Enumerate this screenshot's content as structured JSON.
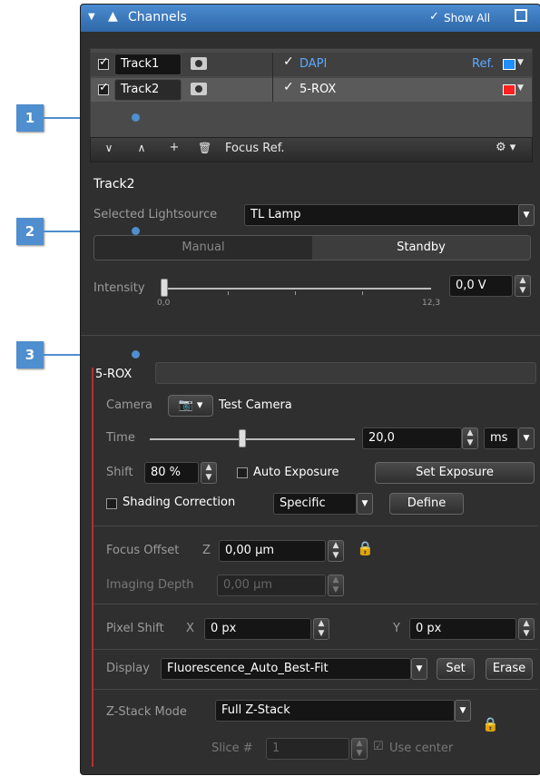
{
  "header": {
    "title": "Channels",
    "show_all": "Show All"
  },
  "channels": {
    "tracks": [
      {
        "track": "Track1",
        "checked": true,
        "channel": "DAPI",
        "ref": "Ref.",
        "color": "#1f8fff",
        "selected": false
      },
      {
        "track": "Track2",
        "checked": true,
        "channel": "5-ROX",
        "ref": "",
        "color": "#ff2020",
        "selected": true
      }
    ],
    "toolbar": {
      "down": "⌄",
      "up": "^",
      "add": "+",
      "focus_ref": "Focus Ref.",
      "gear": "⚙"
    }
  },
  "track": {
    "title": "Track2",
    "lightsource_label": "Selected Lightsource",
    "lightsource_value": "TL Lamp",
    "modes": [
      "Manual",
      "Standby"
    ],
    "active_mode": "Standby",
    "intensity_label": "Intensity",
    "intensity_min": "0,0",
    "intensity_max": "12,3",
    "intensity_value": "0,0 V",
    "intensity_fraction": 0.0
  },
  "channel": {
    "name": "5-ROX",
    "camera_label": "Camera",
    "camera_value": "Test Camera",
    "time_label": "Time",
    "time_value": "20,0",
    "time_unit": "ms",
    "time_slider_fraction": 0.47,
    "shift_label": "Shift",
    "shift_value": "80 %",
    "auto_exposure": "Auto Exposure",
    "set_exposure": "Set Exposure",
    "shading": "Shading Correction",
    "shading_mode": "Specific",
    "define": "Define",
    "focus_offset_label": "Focus Offset",
    "focus_z": "Z",
    "focus_value": "0,00 µm",
    "imaging_depth_label": "Imaging Depth",
    "imaging_depth_value": "0,00 µm",
    "pixel_shift_label": "Pixel Shift",
    "pixel_x": "X",
    "pixel_x_value": "0 px",
    "pixel_y": "Y",
    "pixel_y_value": "0 px",
    "display_label": "Display",
    "display_value": "Fluorescence_Auto_Best-Fit",
    "set": "Set",
    "erase": "Erase",
    "zstack_label": "Z-Stack Mode",
    "zstack_value": "Full Z-Stack",
    "slice_label": "Slice #",
    "slice_value": "1",
    "use_center": "Use center"
  },
  "callouts": [
    "1",
    "2",
    "3"
  ]
}
